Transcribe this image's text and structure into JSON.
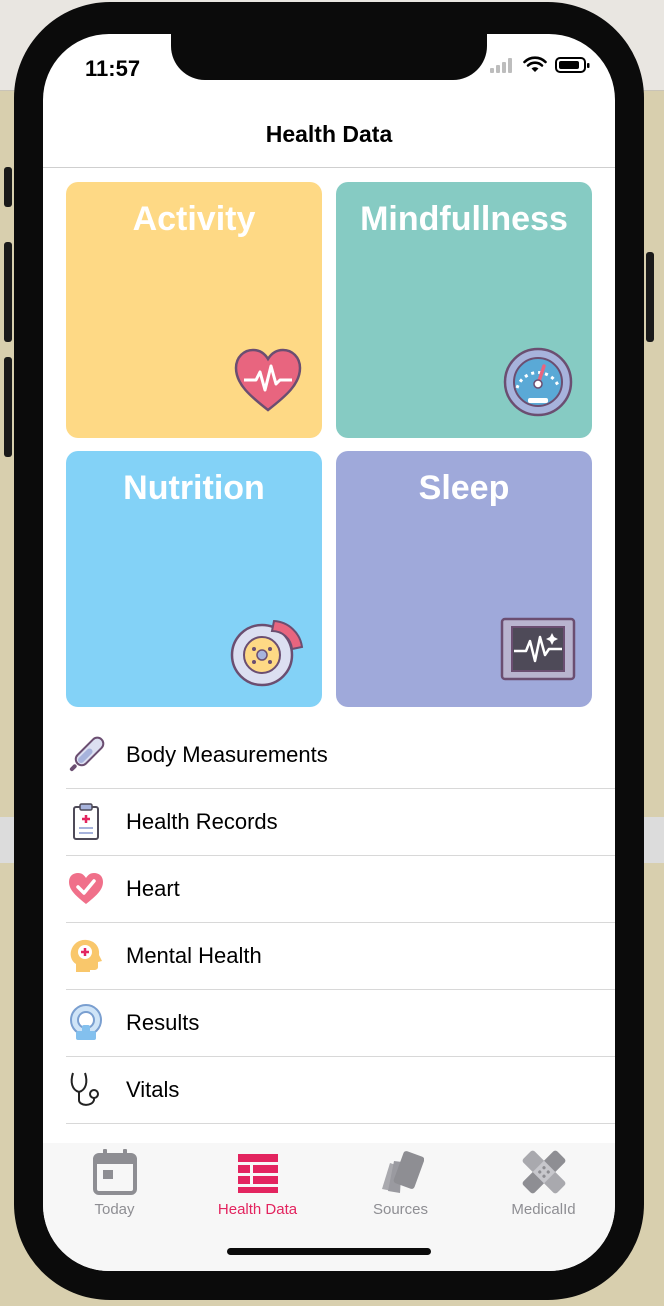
{
  "status_bar": {
    "time": "11:57"
  },
  "navbar": {
    "title": "Health Data"
  },
  "tiles": [
    {
      "title": "Activity",
      "color": "#fed985",
      "icon": "heart-pulse-icon"
    },
    {
      "title": "Mindfullness",
      "color": "#86cbc3",
      "icon": "gauge-icon"
    },
    {
      "title": "Nutrition",
      "color": "#83d2f7",
      "icon": "food-plate-icon"
    },
    {
      "title": "Sleep",
      "color": "#9fa9da",
      "icon": "monitor-pulse-icon"
    }
  ],
  "list": [
    {
      "label": "Body Measurements",
      "icon": "thermometer-icon"
    },
    {
      "label": "Health Records",
      "icon": "clipboard-icon"
    },
    {
      "label": "Heart",
      "icon": "heart-check-icon"
    },
    {
      "label": "Mental Health",
      "icon": "head-cross-icon"
    },
    {
      "label": "Results",
      "icon": "scanner-icon"
    },
    {
      "label": "Vitals",
      "icon": "stethoscope-icon"
    }
  ],
  "tabs": [
    {
      "label": "Today",
      "icon": "calendar-icon",
      "active": false
    },
    {
      "label": "Health Data",
      "icon": "grid-list-icon",
      "active": true
    },
    {
      "label": "Sources",
      "icon": "cards-icon",
      "active": false
    },
    {
      "label": "MedicalId",
      "icon": "medical-id-icon",
      "active": false
    }
  ],
  "colors": {
    "accent": "#e3245f",
    "inactive_tab": "#8e8e93"
  }
}
